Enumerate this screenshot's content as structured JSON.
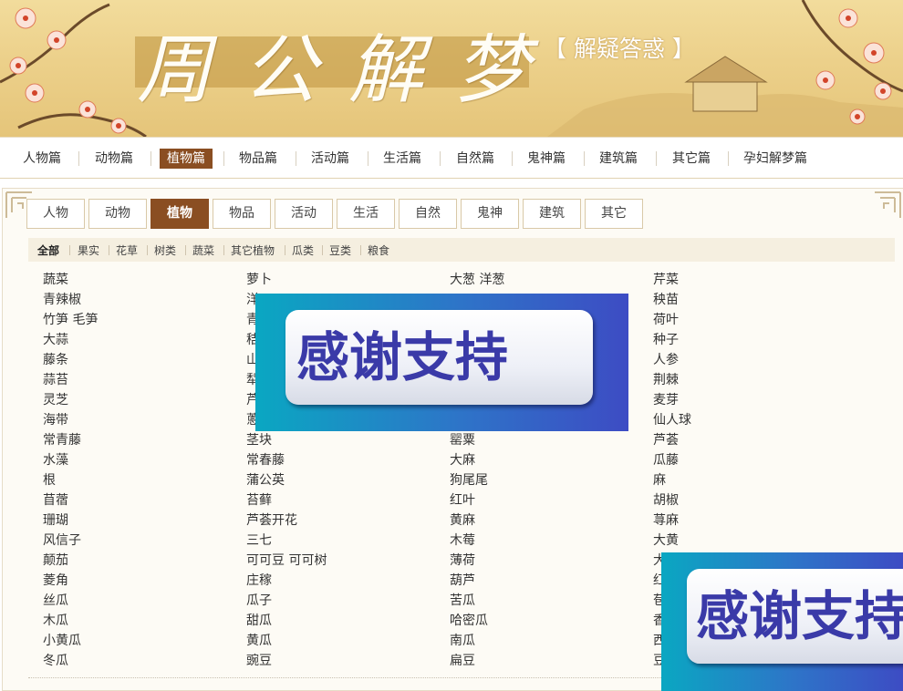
{
  "banner": {
    "title": "周公解梦",
    "subtitle": "【 解疑答惑 】"
  },
  "topnav": {
    "items": [
      "人物篇",
      "动物篇",
      "植物篇",
      "物品篇",
      "活动篇",
      "生活篇",
      "自然篇",
      "鬼神篇",
      "建筑篇",
      "其它篇",
      "孕妇解梦篇"
    ],
    "active": "植物篇"
  },
  "tabs": {
    "items": [
      "人物",
      "动物",
      "植物",
      "物品",
      "活动",
      "生活",
      "自然",
      "鬼神",
      "建筑",
      "其它"
    ],
    "active": "植物"
  },
  "filters": {
    "items": [
      "全部",
      "果实",
      "花草",
      "树类",
      "蔬菜",
      "其它植物",
      "瓜类",
      "豆类",
      "粮食"
    ],
    "active": "全部"
  },
  "columns": [
    [
      "蔬菜",
      "青辣椒",
      "竹笋 毛笋",
      "大蒜",
      "藤条",
      "蒜苔",
      "灵芝",
      "海带",
      "常青藤",
      "水藻",
      "根",
      "苜蓿",
      "珊瑚",
      "风信子",
      "颠茄",
      "菱角",
      "丝瓜",
      "木瓜",
      "小黄瓜",
      "冬瓜"
    ],
    [
      "萝卜",
      "洋",
      "青",
      "秸",
      "山",
      "犁",
      "芦",
      "蔥",
      "茎块",
      "常春藤",
      "蒲公英",
      "苔藓",
      "芦荟开花",
      "三七",
      "可可豆 可可树",
      "庄稼",
      "瓜子",
      "甜瓜",
      "黄瓜",
      "豌豆"
    ],
    [
      "大葱 洋葱",
      "",
      "",
      "",
      "",
      "",
      "",
      "",
      "罂粟",
      "大麻",
      "狗尾尾",
      "红叶",
      "黄麻",
      "木莓",
      "薄荷",
      "葫芦",
      "苦瓜",
      "哈密瓜",
      "南瓜",
      "扁豆"
    ],
    [
      "芹菜",
      "秧苗",
      "荷叶",
      "种子",
      "人参",
      "荆棘",
      "麦芽",
      "仙人球",
      "芦荟",
      "瓜藤",
      "麻",
      "胡椒",
      "荨麻",
      "大黄",
      "大",
      "红",
      "苞",
      "香",
      "西",
      "豆"
    ]
  ],
  "overlay_ads": [
    {
      "text": "感谢支持"
    },
    {
      "text": "感谢支持"
    }
  ],
  "colors": {
    "accent": "#8a4e22",
    "banner": "#ecd08a",
    "ad_blue": "#3d4cc4"
  }
}
